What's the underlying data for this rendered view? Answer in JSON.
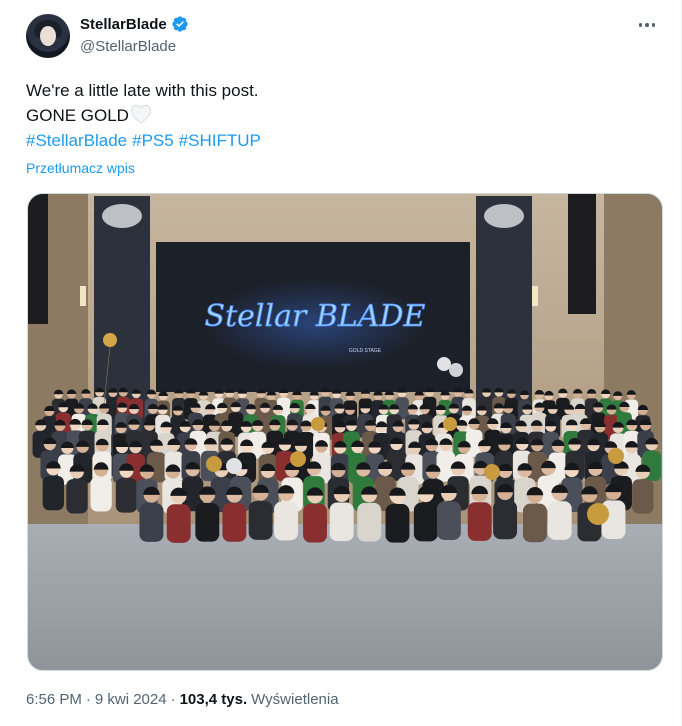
{
  "author": {
    "display_name": "StellarBlade",
    "handle": "@StellarBlade",
    "verified": true
  },
  "tweet": {
    "lines": [
      "We're a little late with this post.",
      "GONE GOLD"
    ],
    "hashtags": [
      "#StellarBlade",
      "#PS5",
      "#SHIFTUP"
    ],
    "translate_label": "Przetłumacz wpis"
  },
  "media": {
    "screen_logo": "Stellar BLADE",
    "screen_subtitle": "GOLD STAGE"
  },
  "meta": {
    "time": "6:56 PM",
    "date": "9 kwi 2024",
    "separator": "·",
    "views_count": "103,4 tys.",
    "views_label": "Wyświetlenia"
  },
  "colors": {
    "link": "#1d9bf0",
    "verified": "#1d9bf0",
    "secondary_text": "#536471",
    "primary_text": "#0f1419"
  },
  "icons": {
    "verified": "verified-badge-icon",
    "heart": "white-heart-icon",
    "more": "more-dots-icon"
  }
}
